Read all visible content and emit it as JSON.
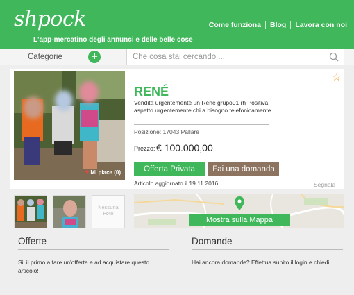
{
  "header": {
    "logo": "shpock",
    "tagline": "L'app-mercatino degli annunci e delle belle cose",
    "nav": [
      "Come funziona",
      "Blog",
      "Lavora con noi"
    ],
    "brand_color": "#3fb75a"
  },
  "search": {
    "category_label": "Categorie",
    "add_icon": "plus-circle-icon",
    "placeholder": "Che cosa stai cercando ...",
    "search_icon": "magnifier-icon"
  },
  "listing": {
    "title": "RENÉ",
    "description": "Vendita urgentemente un René grupo01 rh Positiva aspetto urgentemente chi a bisogno telefonicamente",
    "position": "Posizione: 17043 Pallare",
    "price_label": "Prezzo:",
    "price_value": "€ 100.000,00",
    "offer_button": "Offerta Privata",
    "ask_button": "Fai una domanda",
    "updated": "Articolo aggiornato il 19.11.2016.",
    "report": "Segnala",
    "likes": "Mi piace (0)",
    "favorite_icon": "star-outline-icon",
    "ask_button_color": "#8c7461"
  },
  "thumbnails": [
    {
      "kind": "photo"
    },
    {
      "kind": "photo"
    },
    {
      "kind": "placeholder",
      "text": "Nessuna Foto"
    }
  ],
  "map": {
    "button": "Mostra sulla Mappa",
    "pin_icon": "map-pin-icon"
  },
  "offers": {
    "heading": "Offerte",
    "text": "Sii il primo a fare un'offerta e ad acquistare questo articolo!"
  },
  "questions": {
    "heading": "Domande",
    "text": "Hai ancora domande? Effettua subito il login e chiedi!"
  }
}
